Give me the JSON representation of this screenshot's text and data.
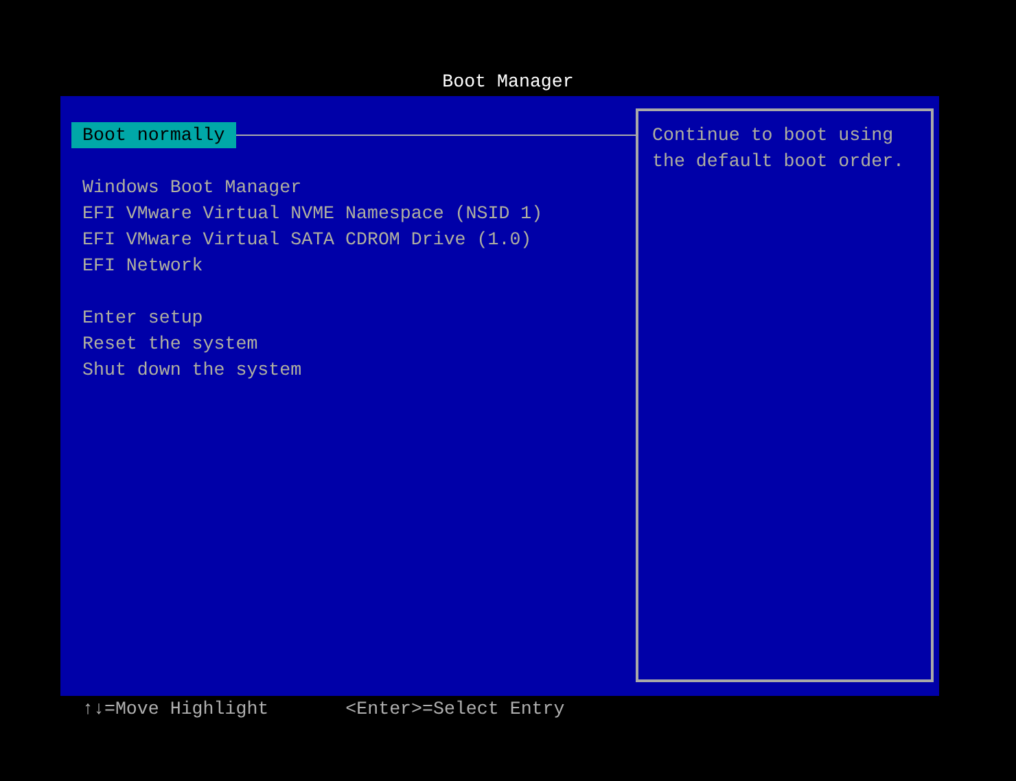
{
  "title": "Boot Manager",
  "menu_groups": [
    [
      {
        "label": "Boot normally",
        "selected": true
      }
    ],
    [
      {
        "label": "Windows Boot Manager",
        "selected": false
      },
      {
        "label": "EFI VMware Virtual NVME Namespace (NSID 1)",
        "selected": false
      },
      {
        "label": "EFI VMware Virtual SATA CDROM Drive (1.0)",
        "selected": false
      },
      {
        "label": "EFI Network",
        "selected": false
      }
    ],
    [
      {
        "label": "Enter setup",
        "selected": false
      },
      {
        "label": "Reset the system",
        "selected": false
      },
      {
        "label": "Shut down the system",
        "selected": false
      }
    ]
  ],
  "help_text": "Continue to boot using the default boot order.",
  "key_hints": [
    "↑↓=Move Highlight",
    "<Enter>=Select Entry"
  ]
}
